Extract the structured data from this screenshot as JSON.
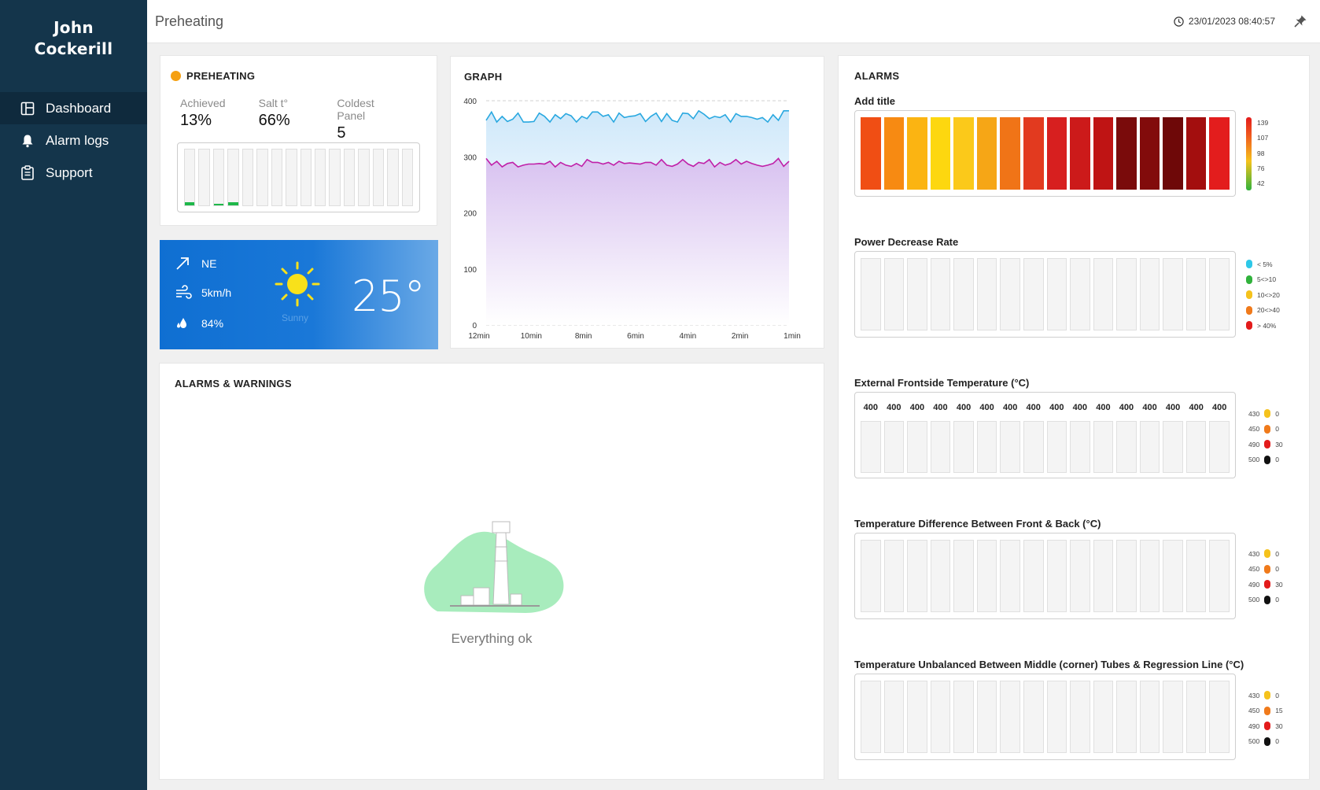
{
  "brand": {
    "line1": "John",
    "line2": "Cockerill"
  },
  "nav": [
    {
      "label": "Dashboard",
      "icon": "dashboard-icon",
      "active": true
    },
    {
      "label": "Alarm logs",
      "icon": "bell-icon",
      "active": false
    },
    {
      "label": "Support",
      "icon": "clipboard-icon",
      "active": false
    }
  ],
  "header": {
    "title": "Preheating",
    "datetime": "23/01/2023 08:40:57"
  },
  "preheating": {
    "title": "PREHEATING",
    "status_color": "#f5a011",
    "stats": [
      {
        "label": "Achieved",
        "value": "13%"
      },
      {
        "label": "Salt t°",
        "value": "66%"
      },
      {
        "label": "Coldest Panel",
        "value": "5"
      }
    ],
    "panel_fill": [
      0.05,
      0,
      0.03,
      0.05,
      0,
      0,
      0,
      0,
      0,
      0,
      0,
      0,
      0,
      0,
      0,
      0
    ]
  },
  "weather": {
    "wind_dir": "NE",
    "wind_speed": "5km/h",
    "humidity": "84%",
    "condition": "Sunny",
    "temperature": "25°"
  },
  "graph": {
    "title": "GRAPH",
    "chart_data": {
      "type": "area",
      "x_ticks": [
        "12min",
        "10min",
        "8min",
        "6min",
        "4min",
        "2min",
        "1min"
      ],
      "y_ticks": [
        "400",
        "300",
        "200",
        "100",
        "0"
      ],
      "ylim": [
        0,
        400
      ],
      "series": [
        {
          "color": "#29a8e0",
          "fill": "#d6edfb",
          "values": [
            365,
            380,
            362,
            372,
            363,
            367,
            378,
            362,
            362,
            363,
            378,
            372,
            362,
            375,
            368,
            377,
            373,
            362,
            372,
            368,
            380,
            380,
            372,
            375,
            362,
            378,
            370,
            372,
            373,
            377,
            363,
            372,
            378,
            363,
            377,
            365,
            362,
            378,
            377,
            368,
            382,
            376,
            368,
            372,
            370,
            375,
            362,
            377,
            372,
            372,
            370,
            367,
            370,
            362,
            375,
            365,
            382,
            382
          ]
        },
        {
          "color": "#c020a8",
          "fill": "#e0cdf3",
          "values": [
            297,
            285,
            292,
            282,
            288,
            290,
            282,
            285,
            287,
            287,
            288,
            287,
            292,
            282,
            290,
            285,
            283,
            288,
            283,
            295,
            290,
            290,
            287,
            290,
            285,
            292,
            288,
            289,
            288,
            287,
            290,
            290,
            285,
            295,
            285,
            283,
            287,
            295,
            287,
            283,
            290,
            288,
            295,
            282,
            290,
            285,
            288,
            295,
            287,
            292,
            288,
            285,
            283,
            285,
            288,
            297,
            283,
            292
          ]
        }
      ]
    }
  },
  "alarms_warnings": {
    "title": "ALARMS & WARNINGS",
    "empty_text": "Everything ok"
  },
  "alarms": {
    "title": "ALARMS",
    "heatmap": {
      "title": "Add title",
      "cells": [
        "#f04e14",
        "#f78a12",
        "#fbb412",
        "#fdd70f",
        "#fbc91a",
        "#f6a616",
        "#f07417",
        "#e23a1f",
        "#d71f1f",
        "#cc1a1a",
        "#bf1414",
        "#7a0b0b",
        "#820b0b",
        "#6e0808",
        "#a30e0e",
        "#e31d1d"
      ],
      "scale": [
        "139",
        "107",
        "98",
        "76",
        "42"
      ]
    },
    "power": {
      "title": "Power Decrease Rate",
      "legend": [
        {
          "label": "< 5%",
          "color": "#2ec8e8"
        },
        {
          "label": "5<>10",
          "color": "#31b23c"
        },
        {
          "label": "10<>20",
          "color": "#f5c21c"
        },
        {
          "label": "20<>40",
          "color": "#f07a1b"
        },
        {
          "label": "> 40%",
          "color": "#e31b1b"
        }
      ]
    },
    "external": {
      "title": "External Frontside Temperature (°C)",
      "values": [
        "400",
        "400",
        "400",
        "400",
        "400",
        "400",
        "400",
        "400",
        "400",
        "400",
        "400",
        "400",
        "400",
        "400",
        "400",
        "400"
      ],
      "legend": [
        {
          "threshold": "430",
          "color": "#f5c21c",
          "count": "0"
        },
        {
          "threshold": "450",
          "color": "#f07a1b",
          "count": "0"
        },
        {
          "threshold": "490",
          "color": "#e31b1b",
          "count": "30"
        },
        {
          "threshold": "500",
          "color": "#111111",
          "count": "0"
        }
      ]
    },
    "diff": {
      "title": "Temperature Difference Between Front & Back (°C)",
      "legend": [
        {
          "threshold": "430",
          "color": "#f5c21c",
          "count": "0"
        },
        {
          "threshold": "450",
          "color": "#f07a1b",
          "count": "0"
        },
        {
          "threshold": "490",
          "color": "#e31b1b",
          "count": "30"
        },
        {
          "threshold": "500",
          "color": "#111111",
          "count": "0"
        }
      ]
    },
    "unbalanced": {
      "title": "Temperature Unbalanced Between Middle (corner) Tubes & Regression Line (°C)",
      "legend": [
        {
          "threshold": "430",
          "color": "#f5c21c",
          "count": "0"
        },
        {
          "threshold": "450",
          "color": "#f07a1b",
          "count": "15"
        },
        {
          "threshold": "490",
          "color": "#e31b1b",
          "count": "30"
        },
        {
          "threshold": "500",
          "color": "#111111",
          "count": "0"
        }
      ]
    }
  }
}
